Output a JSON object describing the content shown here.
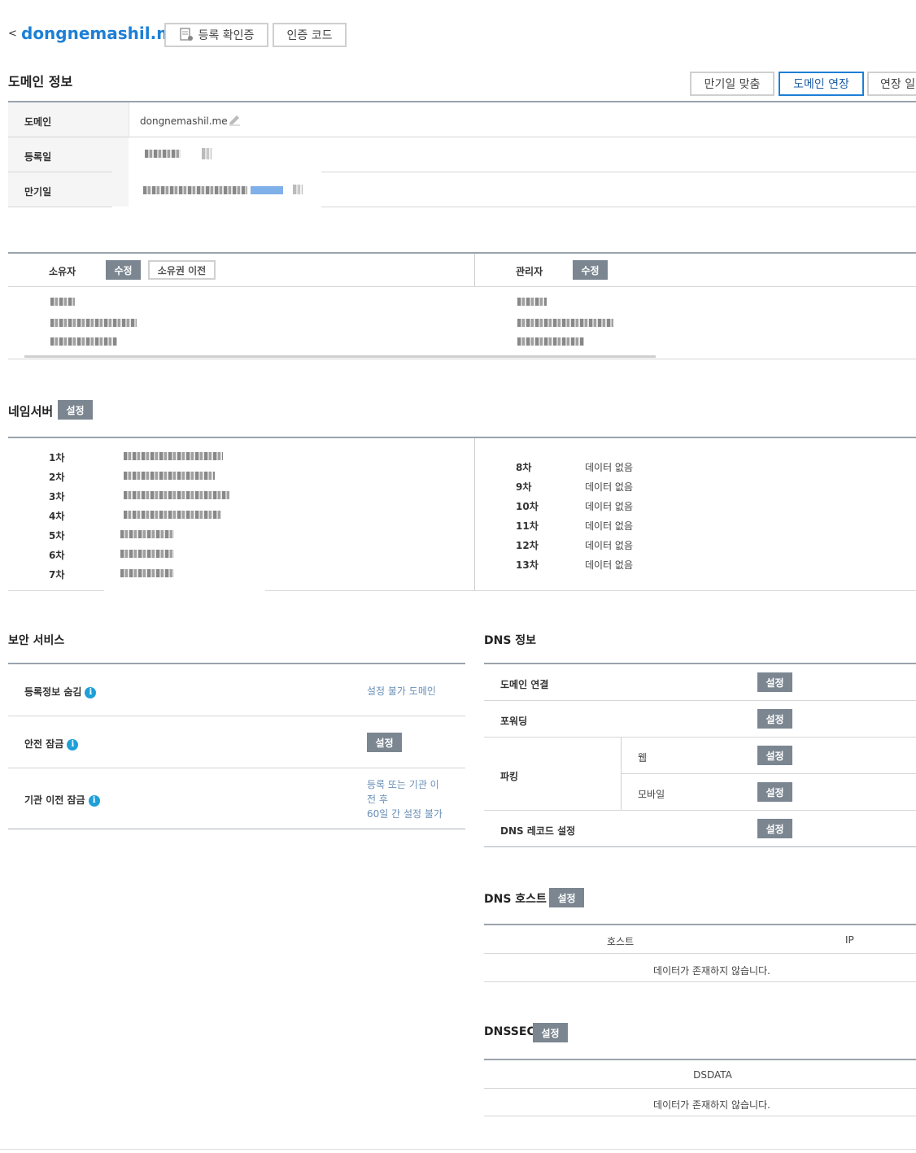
{
  "header": {
    "back_glyph": "<",
    "domain_title": "dongnemashil.me",
    "reg_cert_button": "등록 확인증",
    "auth_code_button": "인증 코드"
  },
  "domain_info": {
    "title": "도메인 정보",
    "buttons": {
      "match_expiry": "만기일 맞춤",
      "extend_domain": "도메인 연장",
      "extend_date": "연장 일"
    },
    "rows": {
      "domain_label": "도메인",
      "domain_value": "dongnemashil.me",
      "registered_label": "등록일",
      "expiry_label": "만기일"
    }
  },
  "contacts": {
    "owner_label": "소유자",
    "owner_edit": "수정",
    "owner_transfer": "소유권 이전",
    "admin_label": "관리자",
    "admin_edit": "수정"
  },
  "nameservers": {
    "title": "네임서버",
    "set_button": "설정",
    "left": [
      "1차",
      "2차",
      "3차",
      "4차",
      "5차",
      "6차",
      "7차"
    ],
    "right": [
      {
        "label": "8차",
        "value": "데이터 없음"
      },
      {
        "label": "9차",
        "value": "데이터 없음"
      },
      {
        "label": "10차",
        "value": "데이터 없음"
      },
      {
        "label": "11차",
        "value": "데이터 없음"
      },
      {
        "label": "12차",
        "value": "데이터 없음"
      },
      {
        "label": "13차",
        "value": "데이터 없음"
      }
    ]
  },
  "security": {
    "title": "보안 서비스",
    "whois_privacy": "등록정보 숨김",
    "whois_privacy_status": "설정 불가 도메인",
    "safe_lock": "안전 잠금",
    "safe_lock_button": "설정",
    "transfer_lock": "기관 이전 잠금",
    "transfer_lock_status_1": "등록 또는 기관 이",
    "transfer_lock_status_2": "전 후",
    "transfer_lock_status_3": "60일 간 설정 불가",
    "info_glyph": "i"
  },
  "dns_info": {
    "title": "DNS 정보",
    "domain_connect": "도메인 연결",
    "forwarding": "포워딩",
    "parking": "파킹",
    "parking_web": "웹",
    "parking_mobile": "모바일",
    "dns_record": "DNS 레코드 설정",
    "set_button": "설정"
  },
  "dns_host": {
    "title": "DNS 호스트",
    "set_button": "설정",
    "col_host": "호스트",
    "col_ip": "IP",
    "empty": "데이터가 존재하지 않습니다."
  },
  "dnssec": {
    "title": "DNSSEC",
    "set_button": "설정",
    "col_dsdata": "DSDATA",
    "empty": "데이터가 존재하지 않습니다."
  },
  "colors": {
    "link_blue": "#1d7fd6",
    "button_gray": "#7b8691",
    "info_blue": "#1e9fd8"
  }
}
